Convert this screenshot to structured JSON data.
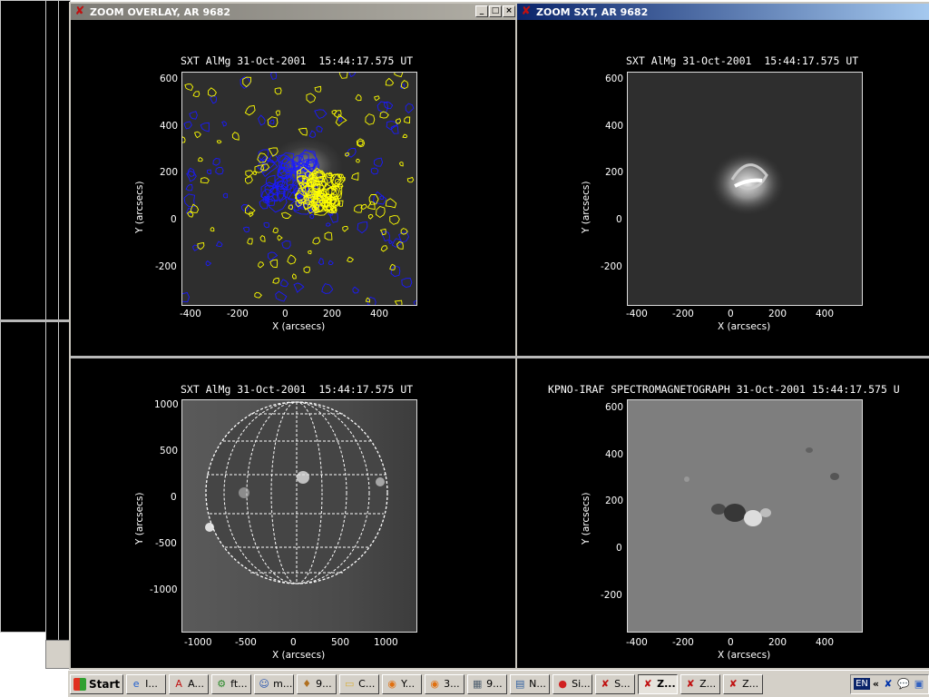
{
  "windows": {
    "overlay": {
      "title": "ZOOM OVERLAY, AR 9682",
      "state": "inactive"
    },
    "sxt": {
      "title": "ZOOM SXT, AR 9682",
      "state": "active"
    }
  },
  "colors": {
    "contour_positive": "#ffff00",
    "contour_negative": "#1a1aff",
    "active_title": "#0a246a",
    "inactive_title": "#7d7b75"
  },
  "panels": {
    "top_left": {
      "title": "SXT AlMg 31-Oct-2001  15:44:17.575 UT",
      "xlabel": "X (arcsecs)",
      "ylabel": "Y (arcsecs)",
      "xticks": [
        "-400",
        "-200",
        "0",
        "200",
        "400"
      ],
      "yticks": [
        "600",
        "400",
        "200",
        "0",
        "-200"
      ],
      "content": "SXT image with magnetogram contours"
    },
    "top_right": {
      "title": "SXT AlMg 31-Oct-2001  15:44:17.575 UT",
      "xlabel": "X (arcsecs)",
      "ylabel": "Y (arcsecs)",
      "xticks": [
        "-400",
        "-200",
        "0",
        "200",
        "400"
      ],
      "yticks": [
        "600",
        "400",
        "200",
        "0",
        "-200"
      ]
    },
    "bottom_left": {
      "title": "SXT AlMg 31-Oct-2001  15:44:17.575 UT",
      "xlabel": "X (arcsecs)",
      "ylabel": "Y (arcsecs)",
      "xticks": [
        "-1000",
        "-500",
        "0",
        "500",
        "1000"
      ],
      "yticks": [
        "1000",
        "500",
        "0",
        "-500",
        "-1000"
      ]
    },
    "bottom_right": {
      "title": "KPNO-IRAF SPECTROMAGNETOGRAPH 31-Oct-2001 15:44:17.575 U",
      "xlabel": "X (arcsecs)",
      "ylabel": "Y (arcsecs)",
      "xticks": [
        "-400",
        "-200",
        "0",
        "200",
        "400"
      ],
      "yticks": [
        "600",
        "400",
        "200",
        "0",
        "-200"
      ]
    }
  },
  "taskbar": {
    "start": "Start",
    "items": [
      {
        "label": "I...",
        "icon": "ie-icon"
      },
      {
        "label": "A...",
        "icon": "adobe-icon"
      },
      {
        "label": "ft...",
        "icon": "ftp-icon"
      },
      {
        "label": "m...",
        "icon": "messenger-icon"
      },
      {
        "label": "9...",
        "icon": "app-icon"
      },
      {
        "label": "C...",
        "icon": "folder-icon"
      },
      {
        "label": "Y...",
        "icon": "firefox-icon"
      },
      {
        "label": "3...",
        "icon": "firefox-icon"
      },
      {
        "label": "9...",
        "icon": "image-viewer-icon"
      },
      {
        "label": "N...",
        "icon": "notepad-icon"
      },
      {
        "label": "Si...",
        "icon": "record-icon"
      },
      {
        "label": "S...",
        "icon": "idl-icon"
      },
      {
        "label": "Z...",
        "icon": "idl-icon",
        "pressed": true
      },
      {
        "label": "Z...",
        "icon": "idl-icon"
      },
      {
        "label": "Z...",
        "icon": "idl-icon"
      }
    ],
    "tray": {
      "lang": "EN",
      "chevron": "«"
    }
  }
}
